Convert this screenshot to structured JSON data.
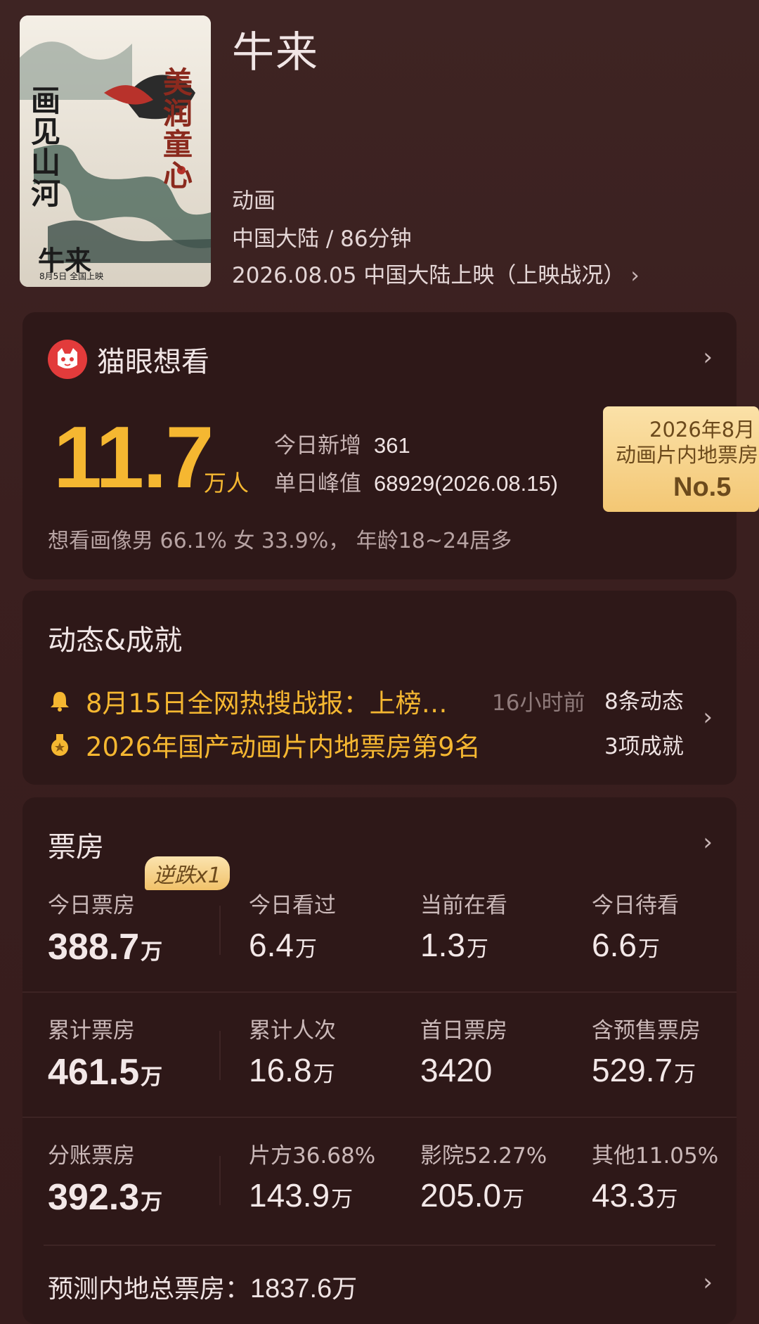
{
  "movie": {
    "title": "牛来",
    "genre": "动画",
    "region_duration": "中国大陆 / 86分钟",
    "release": "2026.08.05 中国大陆上映（上映战况）",
    "poster_text": [
      "画见山河",
      "美润童心",
      "牛来",
      "8月5日 全国上映"
    ]
  },
  "maoyan": {
    "title": "猫眼想看",
    "big_value": "11.7",
    "big_unit": "万人",
    "today_label": "今日新增",
    "today_value": "361",
    "peak_label": "单日峰值",
    "peak_value": "68929(2026.08.15)",
    "portrait": "想看画像男 66.1%  女 33.9%，  年龄18~24居多",
    "rank": {
      "line1": "2026年8月",
      "line2": "动画片内地票房",
      "line3": "No.5"
    }
  },
  "dynamic": {
    "title": "动态&成就",
    "row1": "8月15日全网热搜战报：上榜…",
    "row1_time": "16小时前",
    "row2": "2026年国产动画片内地票房第9名",
    "count1": "8条动态",
    "count2": "3项成就"
  },
  "boxoffice": {
    "title": "票房",
    "badge": "逆跌x1",
    "rows": [
      [
        {
          "label": "今日票房",
          "value": "388.7",
          "unit": "万"
        },
        {
          "label": "今日看过",
          "value": "6.4",
          "unit": "万"
        },
        {
          "label": "当前在看",
          "value": "1.3",
          "unit": "万"
        },
        {
          "label": "今日待看",
          "value": "6.6",
          "unit": "万"
        }
      ],
      [
        {
          "label": "累计票房",
          "value": "461.5",
          "unit": "万"
        },
        {
          "label": "累计人次",
          "value": "16.8",
          "unit": "万"
        },
        {
          "label": "首日票房",
          "value": "3420",
          "unit": ""
        },
        {
          "label": "含预售票房",
          "value": "529.7",
          "unit": "万"
        }
      ],
      [
        {
          "label": "分账票房",
          "value": "392.3",
          "unit": "万"
        },
        {
          "label": "片方36.68%",
          "value": "143.9",
          "unit": "万"
        },
        {
          "label": "影院52.27%",
          "value": "205.0",
          "unit": "万"
        },
        {
          "label": "其他11.05%",
          "value": "43.3",
          "unit": "万"
        }
      ]
    ],
    "forecast_label": "预测内地总票房：",
    "forecast_value": "1837.6",
    "forecast_unit": "万"
  },
  "colors": {
    "accent": "#f5b731",
    "background": "#3a1f1f",
    "card": "#2e1818"
  }
}
